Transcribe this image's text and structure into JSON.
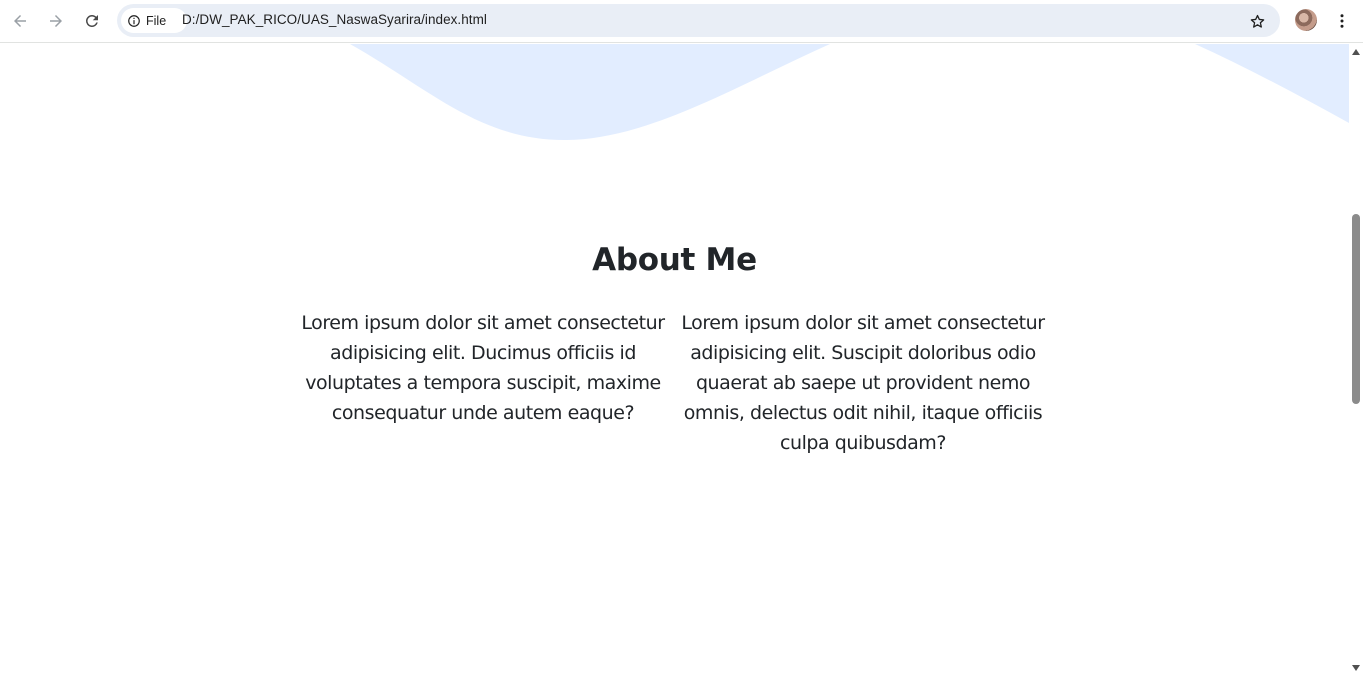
{
  "browser": {
    "site_chip_label": "File",
    "url": "D:/DW_PAK_RICO/UAS_NaswaSyarira/index.html",
    "icons": {
      "back": "arrow-left-icon",
      "forward": "arrow-right-icon",
      "reload": "reload-icon",
      "site_info": "info-icon",
      "bookmark": "star-icon",
      "profile": "avatar",
      "menu": "kebab-menu-icon"
    }
  },
  "page": {
    "about": {
      "title": "About Me",
      "paragraphs": [
        "Lorem ipsum dolor sit amet consectetur adipisicing elit. Ducimus officiis id voluptates a tempora suscipit, maxime consequatur unde autem eaque?",
        "Lorem ipsum dolor sit amet consectetur adipisicing elit. Suscipit doloribus odio quaerat ab saepe ut provident nemo omnis, delectus odit nihil, itaque officiis culpa quibusdam?"
      ]
    },
    "colors": {
      "wave": "#e2edff",
      "text": "#212529"
    }
  }
}
